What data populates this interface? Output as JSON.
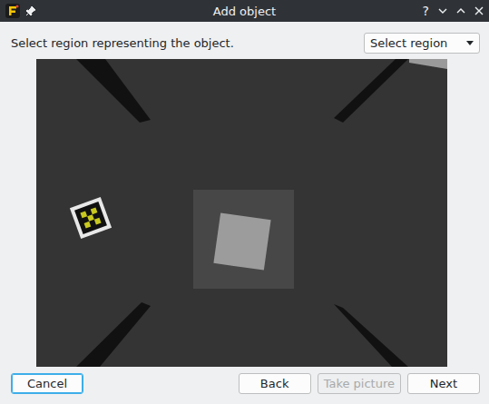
{
  "window": {
    "title": "Add object",
    "help": "?"
  },
  "instruction": "Select region representing the object.",
  "dropdown": {
    "value": "Select region"
  },
  "buttons": [
    {
      "label": "Cancel",
      "focused": true,
      "disabled": false,
      "side": "left"
    },
    {
      "label": "Back",
      "focused": false,
      "disabled": false,
      "side": "right"
    },
    {
      "label": "Take picture",
      "focused": false,
      "disabled": true,
      "side": "right"
    },
    {
      "label": "Next",
      "focused": false,
      "disabled": false,
      "side": "right"
    }
  ]
}
